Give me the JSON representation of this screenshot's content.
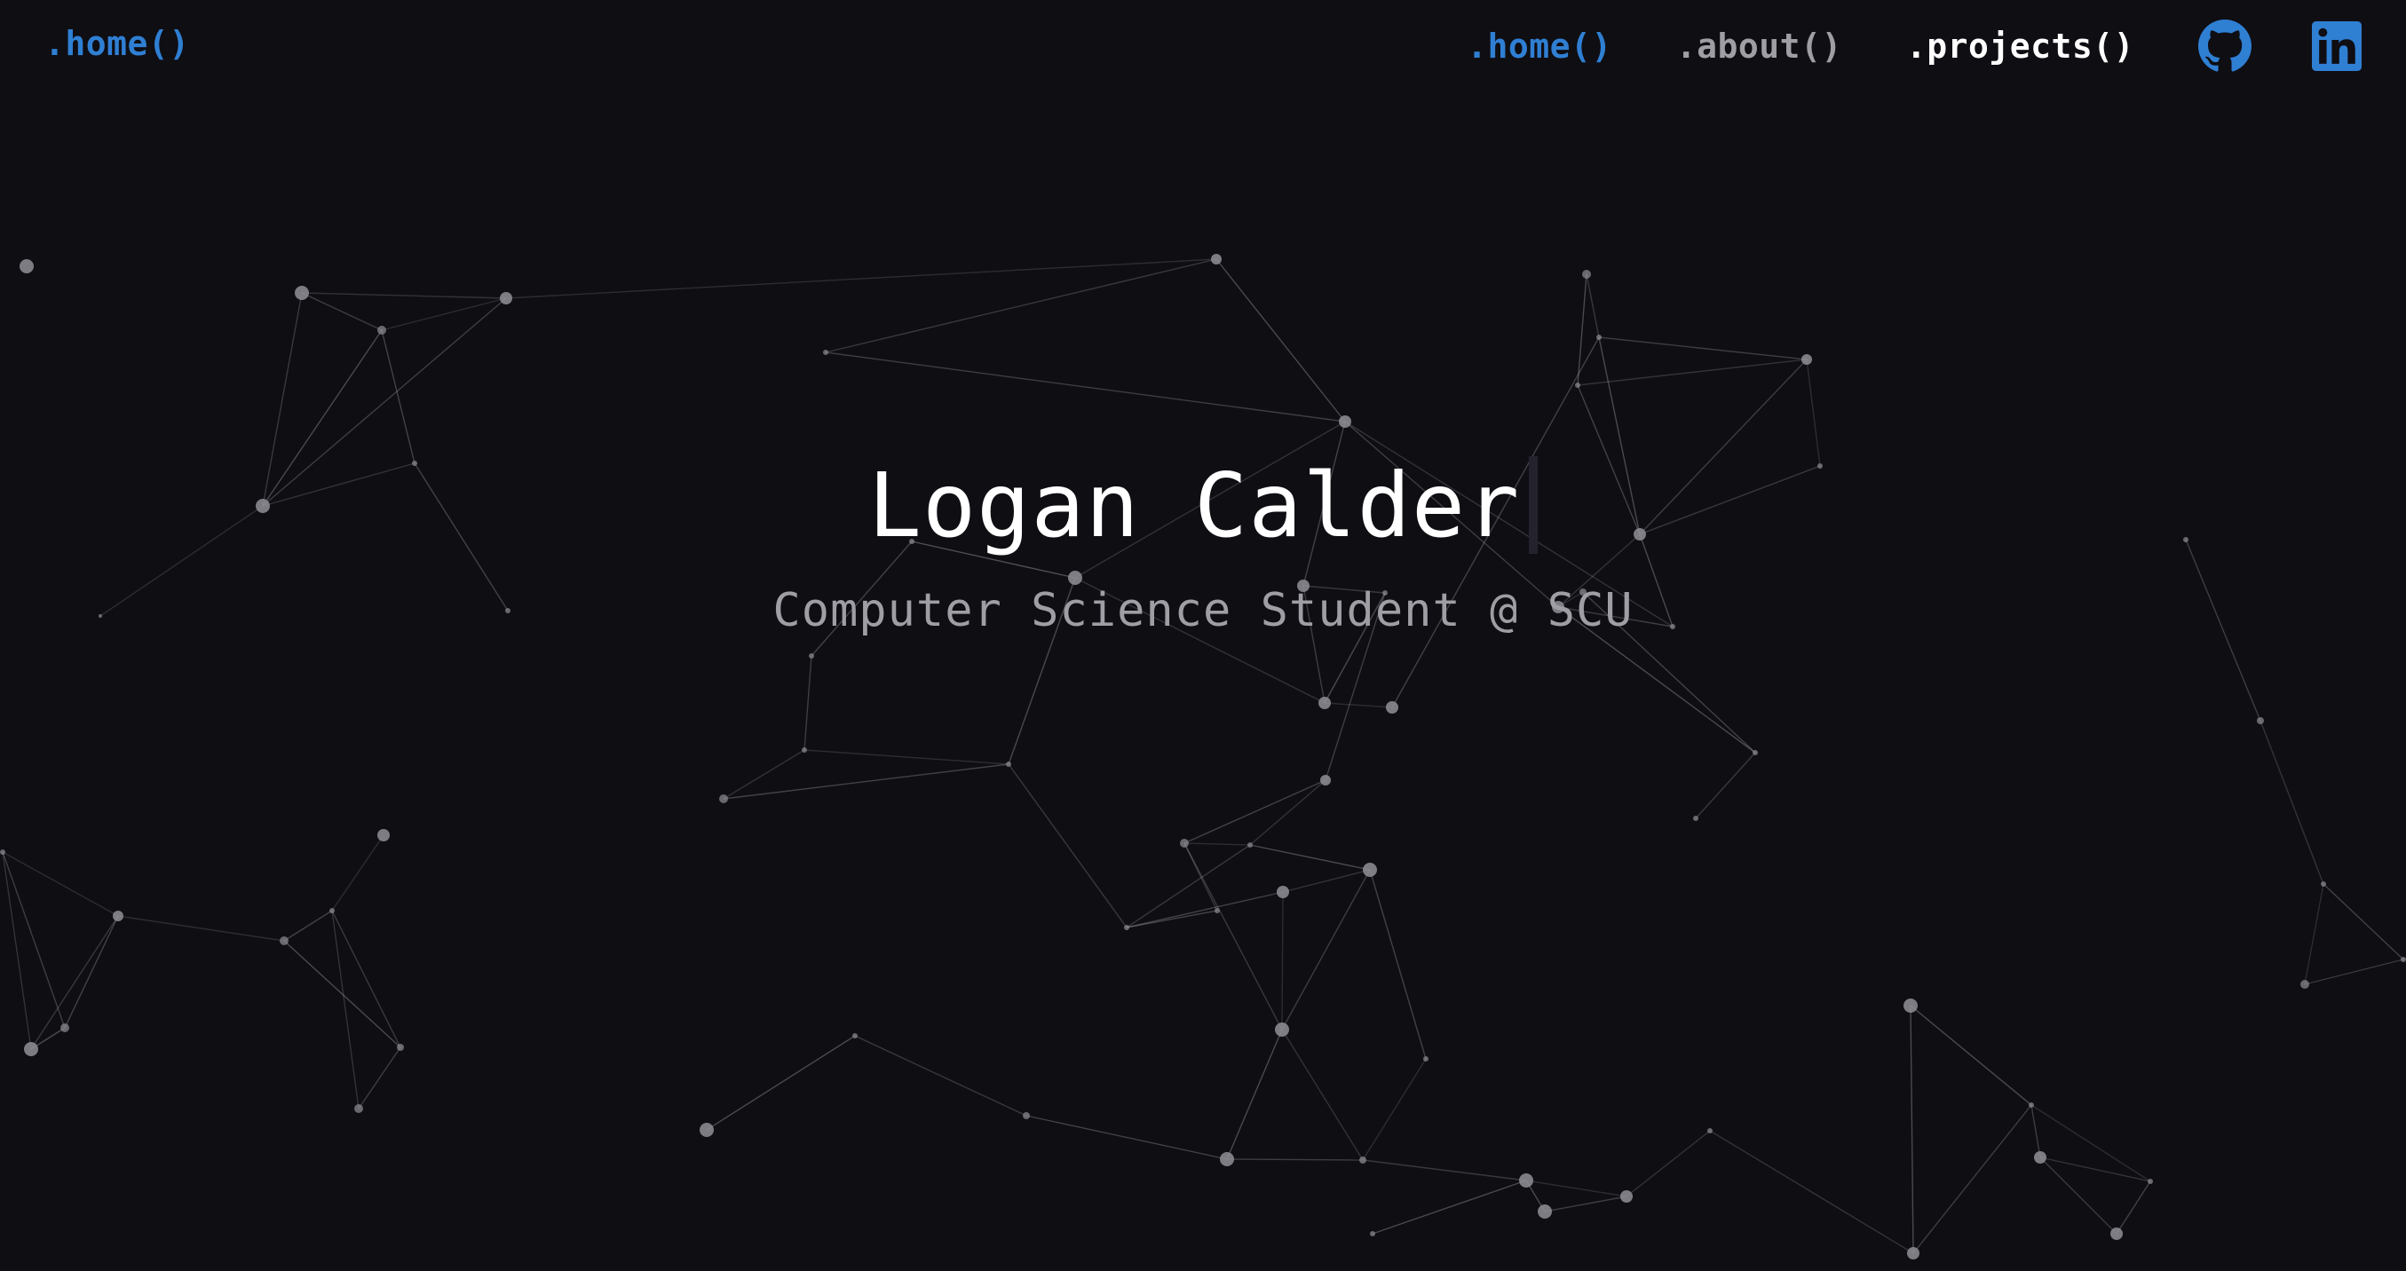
{
  "nav": {
    "brand": ".home()",
    "links": [
      {
        "label": ".home()",
        "state": "active"
      },
      {
        "label": ".about()",
        "state": "normal"
      },
      {
        "label": ".projects()",
        "state": "hover"
      }
    ],
    "icons": [
      "github-icon",
      "linkedin-icon"
    ]
  },
  "hero": {
    "name": "Logan Calder",
    "subtitle": "Computer Science Student @ SCU"
  },
  "colors": {
    "background": "#0f0e13",
    "accent": "#2f7fd3",
    "muted_text": "#9e9ea4",
    "primary_text": "#ffffff",
    "network_node": "#8f8f96"
  }
}
